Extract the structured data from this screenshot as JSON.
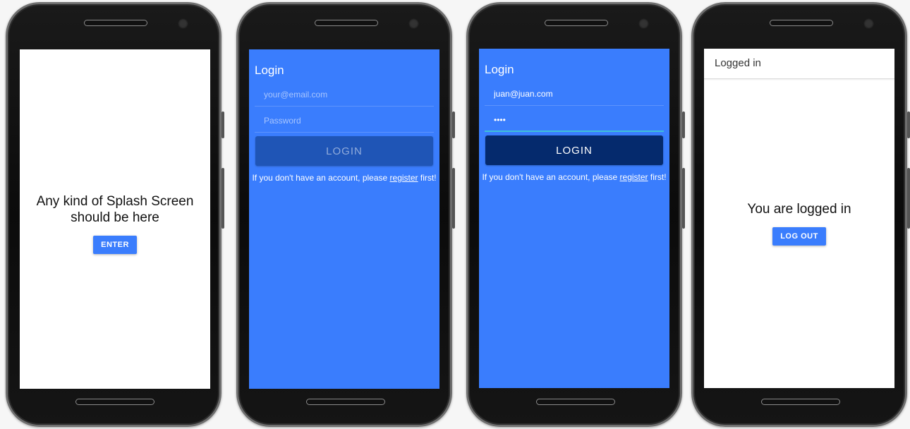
{
  "splash": {
    "message": "Any kind of Splash Screen should be here",
    "enter_label": "ENTER"
  },
  "login_empty": {
    "title": "Login",
    "email_placeholder": "your@email.com",
    "password_placeholder": "Password",
    "login_label": "LOGIN",
    "register_prefix": "If you don't have an account, please ",
    "register_link": "register",
    "register_suffix": " first!"
  },
  "login_filled": {
    "title": "Login",
    "email_value": "juan@juan.com",
    "password_value": "••••",
    "login_label": "LOGIN",
    "register_prefix": "If you don't have an account, please ",
    "register_link": "register",
    "register_suffix": " first!"
  },
  "logged_in": {
    "header_title": "Logged in",
    "message": "You are logged in",
    "logout_label": "LOG OUT"
  },
  "colors": {
    "primary": "#3a7dfd",
    "button_disabled": "#1f55b6",
    "button_active": "#052a6d",
    "focus_underline": "#3ec0d8"
  }
}
